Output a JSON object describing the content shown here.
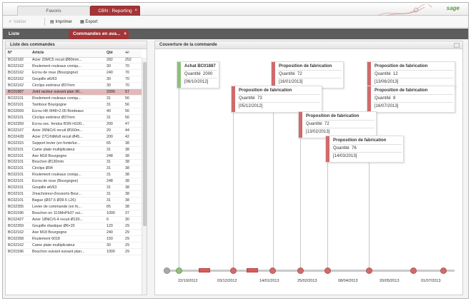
{
  "tabs": {
    "favoris": "Favoris",
    "cbn": "CBN : Reporting",
    "close": "×"
  },
  "brand": {
    "logo": "sage"
  },
  "toolbar": {
    "valider": "Valider",
    "imprimer": "Imprimer",
    "export": "Export"
  },
  "subtabs": {
    "liste": "Liste",
    "commandes": "Commandes en ava...",
    "close": "×"
  },
  "left_panel": {
    "title": "Liste des commandes",
    "columns": [
      "N°",
      "Article",
      "Qté",
      "+/-"
    ],
    "rows": [
      [
        "BC02182",
        "Acier 20MC5 recuit Ø80mm...",
        "282",
        "252"
      ],
      [
        "BC02162",
        "Roulement rouleaux coniqu...",
        "30",
        "70"
      ],
      [
        "BC02162",
        "Ecrou de roue (Bourgogne)",
        "240",
        "70"
      ],
      [
        "BC02162",
        "Goupille ø6/63",
        "30",
        "70"
      ],
      [
        "BC02162",
        "Circlips extérieur Ø37mm",
        "30",
        "70"
      ],
      [
        "BC01887",
        "Joint racleur suivant plan 90...",
        "2000",
        "57"
      ],
      [
        "BC02101",
        "Roulement rouleaux coniqu...",
        "31",
        "56"
      ],
      [
        "BC02101",
        "Tambour Bourgogne",
        "31",
        "56"
      ],
      [
        "BC02069",
        "Ecrou HK M48×2.00 Bordeaux",
        "40",
        "56"
      ],
      [
        "BC02101",
        "Circlips extérieur Ø37mm",
        "31",
        "56"
      ],
      [
        "BC02359",
        "Ecrou sec. fendus BSN H100...",
        "200",
        "47"
      ],
      [
        "BC02167",
        "Acier 36NiCr6 recuit Ø160m...",
        "20",
        "44"
      ],
      [
        "BC02428",
        "Acier 27CrNiMo8 recuit Ø45...",
        "200",
        "42"
      ],
      [
        "BC02315",
        "Support levier (en fonte/tur...",
        "65",
        "38"
      ],
      [
        "BC02101",
        "Came plate multiplicateur",
        "31",
        "38"
      ],
      [
        "BC02101",
        "Axe M18 Bourgogne",
        "248",
        "38"
      ],
      [
        "BC02101",
        "Bouchon Ø130mm",
        "31",
        "38"
      ],
      [
        "BC02101",
        "Circlips Ø34",
        "31",
        "38"
      ],
      [
        "BC02101",
        "Roulement rouleaux coniqu...",
        "31",
        "38"
      ],
      [
        "BC02101",
        "Ecrou de roue (Bourgogne)",
        "248",
        "38"
      ],
      [
        "BC02101",
        "Goupille ø6/63",
        "31",
        "38"
      ],
      [
        "BC02101",
        "2machoires+2ressorts Bour...",
        "31",
        "38"
      ],
      [
        "BC02101",
        "Bague (Ø37.5 Ø39.5 L26)",
        "31",
        "38"
      ],
      [
        "BC02355",
        "Levier de commande (en fo...",
        "65",
        "38"
      ],
      [
        "BC01596",
        "Bouchon en 11SMnPb37 sui...",
        "1000",
        "37"
      ],
      [
        "BC02427",
        "Acier 18NiCr5-4 recuit Ø130...",
        "6",
        "30"
      ],
      [
        "BC02359",
        "Goupille élastique Ø6×20",
        "120",
        "29"
      ],
      [
        "BC02162",
        "Axe M18 Bourgogne",
        "240",
        "29"
      ],
      [
        "BC02358",
        "Roulement 6018",
        "150",
        "29"
      ],
      [
        "BC02162",
        "Came plate multiplicateur",
        "30",
        "29"
      ],
      [
        "BC01596",
        "Bouchon suivant suivant plan...",
        "1000",
        "29"
      ]
    ]
  },
  "right_panel": {
    "title": "Couverture de la commande",
    "events": [
      {
        "title": "Achat BC01887",
        "qty_label": "Quantité",
        "qty": "2000",
        "date": "[06/10/2012]",
        "type": "achat"
      },
      {
        "title": "Proposition de fabrication",
        "qty_label": "Quantité",
        "qty": "72",
        "date": "[16/01/2013]",
        "type": "prop"
      },
      {
        "title": "Proposition de fabrication",
        "qty_label": "Quantité",
        "qty": "12",
        "date": "[13/06/2013]",
        "type": "prop"
      },
      {
        "title": "Proposition de fabrication",
        "qty_label": "Quantité",
        "qty": "73",
        "date": "[05/12/2012]",
        "type": "prop"
      },
      {
        "title": "Proposition de fabrication",
        "qty_label": "Quantité",
        "qty": "8",
        "date": "[16/07/2013]",
        "type": "prop"
      },
      {
        "title": "Proposition de fabrication",
        "qty_label": "Quantité",
        "qty": "72",
        "date": "[13/02/2013]",
        "type": "prop"
      },
      {
        "title": "Proposition de fabrication",
        "qty_label": "Quantité",
        "qty": "76",
        "date": "[14/03/2013]",
        "type": "prop"
      }
    ],
    "ticks": [
      "22/10/2012",
      "03/12/2012",
      "14/01/2013",
      "25/02/2013",
      "08/04/2013",
      "20/05/2013",
      "01/07/2013"
    ]
  },
  "colors": {
    "accent": "#a33537",
    "achat": "#8dc07a",
    "prop": "#d06a6b",
    "dot_grey": "#a9a9a9"
  }
}
